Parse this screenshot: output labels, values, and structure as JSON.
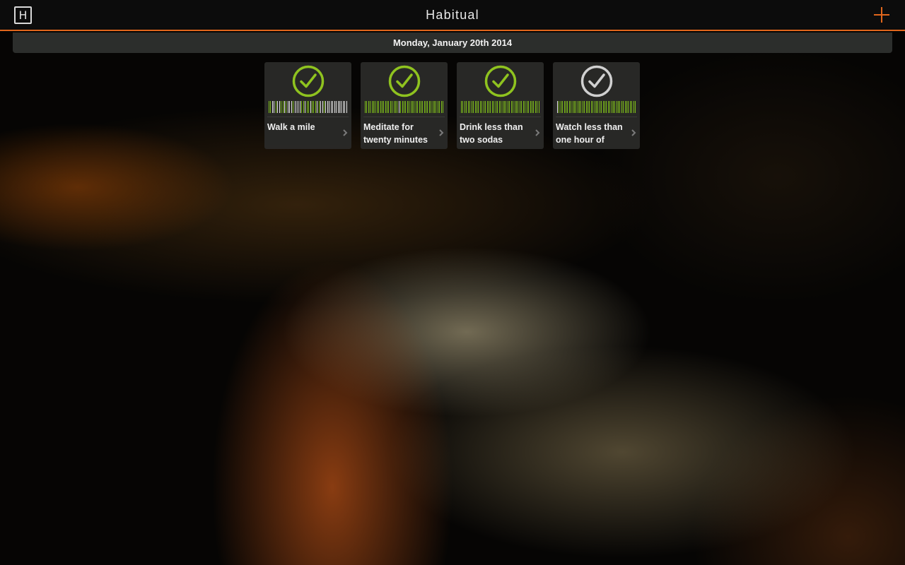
{
  "app": {
    "title": "Habitual",
    "logo_letter": "H"
  },
  "date_label": "Monday, January 20th 2014",
  "colors": {
    "accent": "#e0661c",
    "check_done": "#8fc31f",
    "check_pending": "#d0d0d0",
    "bar_green": "#7fbf1a",
    "bar_white": "#e6e6e6",
    "bar_gray": "#8a8a8a"
  },
  "habits": [
    {
      "label": "Walk a mile",
      "status": "done",
      "icon": "check-circle-icon",
      "history": "ggwwgwwggwgwwwgwbwwggwggwgggwgwwgwwwwwwwwwwwww"
    },
    {
      "label": "Meditate for twenty minutes",
      "status": "done",
      "icon": "check-circle-icon",
      "history": "ggggggggggggggggggggwgggggggggggggggggggggggggg"
    },
    {
      "label": "Drink less than two sodas",
      "status": "done",
      "icon": "check-circle-icon",
      "history": "gggggggggggggggggggggggggggggggggggggggggggggg"
    },
    {
      "label": "Watch less than one hour of",
      "status": "pending",
      "icon": "check-circle-icon",
      "history": "wgggggggggggggggggggggggggggggggggggggggggggggg"
    }
  ]
}
